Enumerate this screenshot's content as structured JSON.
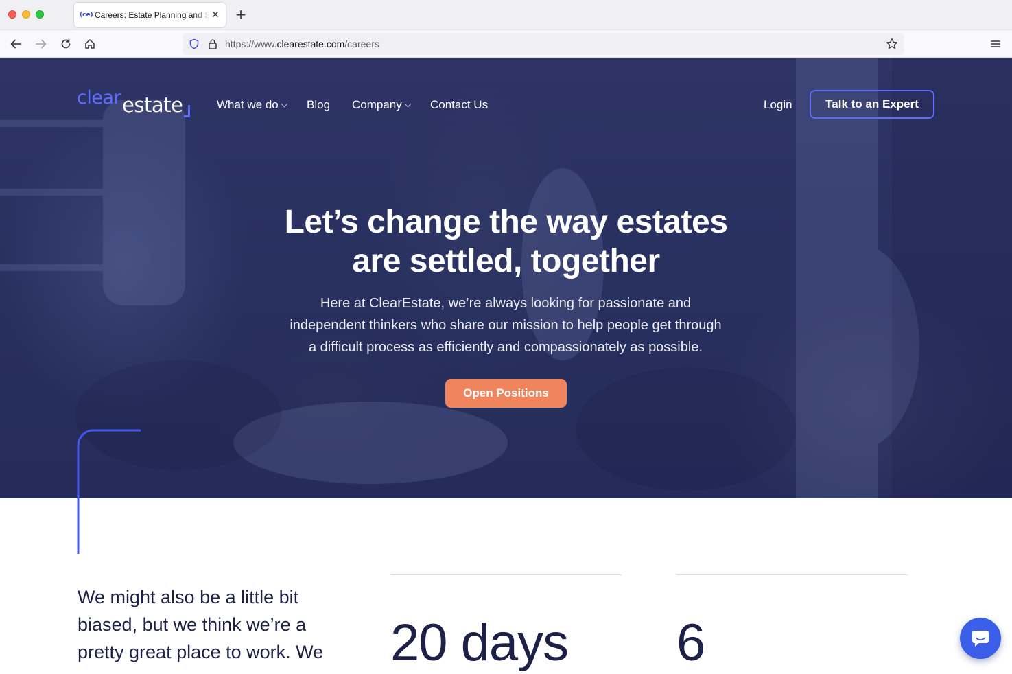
{
  "browser": {
    "tab_title": "Careers: Estate Planning and Se",
    "tab_favicon": "(ce)",
    "url_scheme": "https://www.",
    "url_host": "clearestate.com",
    "url_path": "/careers",
    "icons": [
      "back-icon",
      "forward-icon",
      "reload-icon",
      "home-icon",
      "shield-icon",
      "lock-icon",
      "bookmark-star-icon",
      "hamburger-menu-icon",
      "close-icon",
      "plus-icon"
    ]
  },
  "site": {
    "logo_clear": "clear",
    "logo_estate": "estate",
    "nav": [
      {
        "label": "What we do",
        "has_dropdown": true
      },
      {
        "label": "Blog",
        "has_dropdown": false
      },
      {
        "label": "Company",
        "has_dropdown": true
      },
      {
        "label": "Contact Us",
        "has_dropdown": false
      }
    ],
    "login_label": "Login",
    "expert_button_label": "Talk to an Expert"
  },
  "hero": {
    "title_line1": "Let’s change the way estates",
    "title_line2": "are settled, together",
    "subtitle_line1": "Here at ClearEstate, we’re always looking for passionate and",
    "subtitle_line2": "independent thinkers who share our mission to help people get through",
    "subtitle_line3": "a difficult process as efficiently and compassionately as possible.",
    "cta_label": "Open Positions"
  },
  "lower": {
    "intro_line1": "We might also be a little bit",
    "intro_line2": "biased, but we think we’re a",
    "intro_line3": "pretty great place to work. We",
    "stats": [
      {
        "value": "20 days"
      },
      {
        "value": "6"
      }
    ]
  },
  "colors": {
    "brand_blue": "#5b6cff",
    "cta_orange": "#f0845c",
    "hero_navy": "#283060",
    "text_navy": "#1d2148",
    "chat_blue": "#3b5ee8"
  }
}
